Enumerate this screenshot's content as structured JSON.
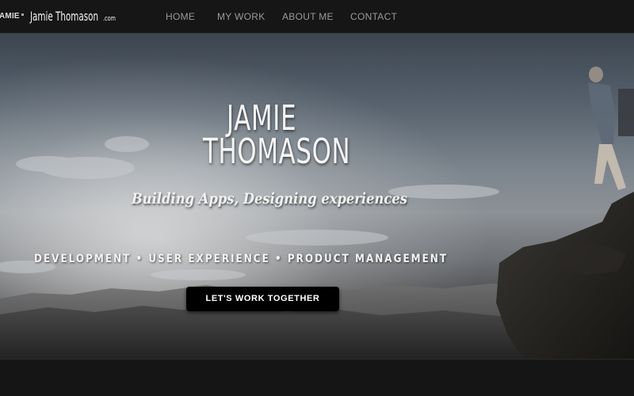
{
  "navbar": {
    "partial_brand": "AMIE",
    "brand": {
      "name": "Jamie Thomason",
      "tld": ".com"
    },
    "links": [
      {
        "label": "HOME"
      },
      {
        "label": "MY WORK"
      },
      {
        "label": "ABOUT ME"
      },
      {
        "label": "CONTACT"
      }
    ]
  },
  "hero": {
    "title_first": "Jamie",
    "title_last": "Thomason",
    "tagline": "Building Apps, Designing experiences",
    "services": "DEVELOPMENT • USER EXPERIENCE • PRODUCT MANAGEMENT",
    "cta_label": "LET'S WORK TOGETHER"
  },
  "colors": {
    "nav_background": "#161616",
    "nav_link": "#9a9a9a",
    "cta_background": "#000000",
    "text_light": "#f5f5f5"
  }
}
